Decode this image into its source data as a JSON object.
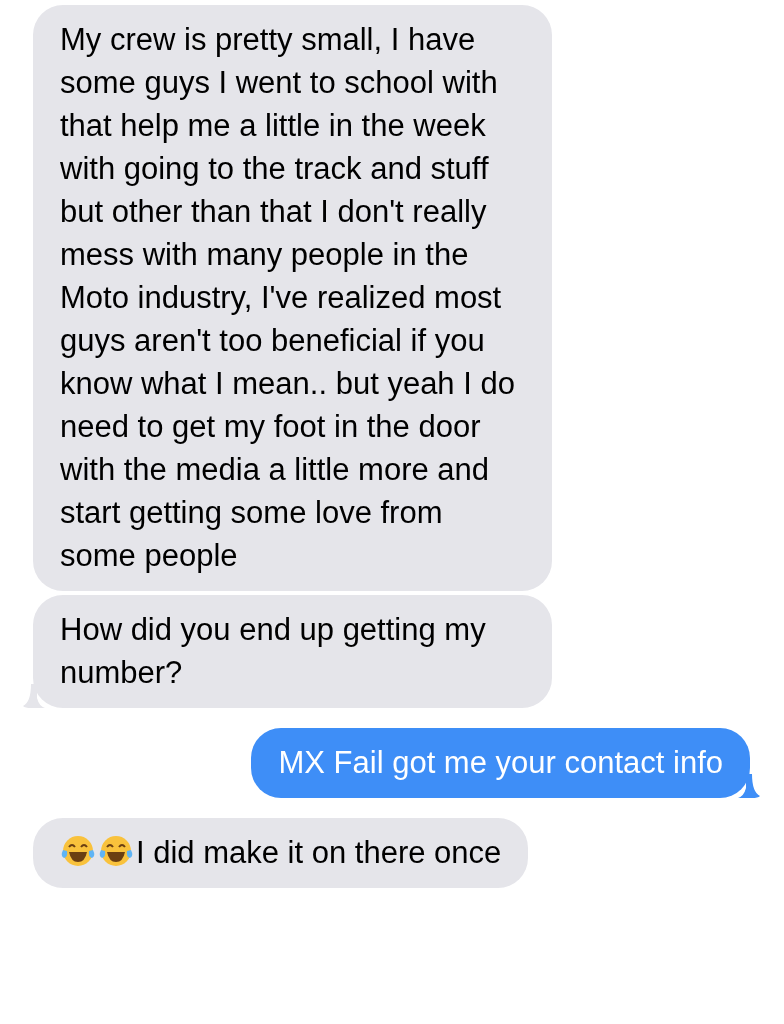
{
  "messages": [
    {
      "kind": "received",
      "tail": false,
      "text": "My crew is pretty small, I have some guys I went to school with that help me a little in the week with going to the track and stuff but other than that I don't really mess with many people in the Moto industry, I've realized most guys aren't too beneficial if you know what I mean.. but yeah I do need to get my foot in the door with the media a little more and start getting some love from some people"
    },
    {
      "kind": "received",
      "tail": true,
      "text": "How did you end up getting my number?"
    },
    {
      "kind": "sent",
      "tail": true,
      "text": "MX Fail got me your contact info"
    },
    {
      "kind": "received",
      "tail": false,
      "leading_icons": [
        {
          "kind": "tears-of-joy"
        },
        {
          "kind": "tears-of-joy"
        }
      ],
      "text": "I did make it on there once"
    }
  ]
}
